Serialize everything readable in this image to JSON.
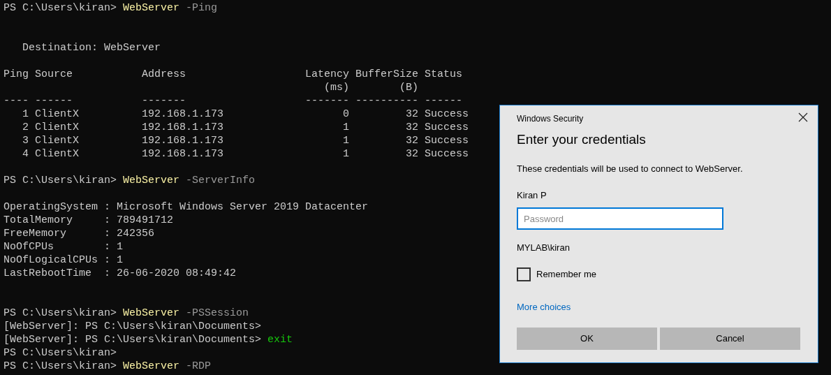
{
  "terminal": {
    "lines": [
      {
        "kind": "text",
        "segments": [
          {
            "kind": "prompt",
            "text": "PS C:\\Users\\kiran> "
          },
          {
            "kind": "command",
            "text": "WebServer"
          },
          {
            "kind": "param",
            "text": " -Ping"
          }
        ]
      },
      {
        "kind": "blank"
      },
      {
        "kind": "blank"
      },
      {
        "kind": "text",
        "segments": [
          {
            "kind": "prompt",
            "text": "   Destination: WebServer"
          }
        ]
      },
      {
        "kind": "blank"
      },
      {
        "kind": "text",
        "segments": [
          {
            "kind": "prompt",
            "text": "Ping Source           Address                   Latency BufferSize Status"
          }
        ]
      },
      {
        "kind": "text",
        "segments": [
          {
            "kind": "prompt",
            "text": "                                                   (ms)        (B)"
          }
        ]
      },
      {
        "kind": "text",
        "segments": [
          {
            "kind": "prompt",
            "text": "---- ------           -------                   ------- ---------- ------"
          }
        ]
      },
      {
        "kind": "text",
        "segments": [
          {
            "kind": "prompt",
            "text": "   1 ClientX          192.168.1.173                   0         32 Success"
          }
        ]
      },
      {
        "kind": "text",
        "segments": [
          {
            "kind": "prompt",
            "text": "   2 ClientX          192.168.1.173                   1         32 Success"
          }
        ]
      },
      {
        "kind": "text",
        "segments": [
          {
            "kind": "prompt",
            "text": "   3 ClientX          192.168.1.173                   1         32 Success"
          }
        ]
      },
      {
        "kind": "text",
        "segments": [
          {
            "kind": "prompt",
            "text": "   4 ClientX          192.168.1.173                   1         32 Success"
          }
        ]
      },
      {
        "kind": "blank"
      },
      {
        "kind": "text",
        "segments": [
          {
            "kind": "prompt",
            "text": "PS C:\\Users\\kiran> "
          },
          {
            "kind": "command",
            "text": "WebServer"
          },
          {
            "kind": "param",
            "text": " -ServerInfo"
          }
        ]
      },
      {
        "kind": "blank"
      },
      {
        "kind": "text",
        "segments": [
          {
            "kind": "prompt",
            "text": "OperatingSystem : Microsoft Windows Server 2019 Datacenter"
          }
        ]
      },
      {
        "kind": "text",
        "segments": [
          {
            "kind": "prompt",
            "text": "TotalMemory     : 789491712"
          }
        ]
      },
      {
        "kind": "text",
        "segments": [
          {
            "kind": "prompt",
            "text": "FreeMemory      : 242356"
          }
        ]
      },
      {
        "kind": "text",
        "segments": [
          {
            "kind": "prompt",
            "text": "NoOfCPUs        : 1"
          }
        ]
      },
      {
        "kind": "text",
        "segments": [
          {
            "kind": "prompt",
            "text": "NoOfLogicalCPUs : 1"
          }
        ]
      },
      {
        "kind": "text",
        "segments": [
          {
            "kind": "prompt",
            "text": "LastRebootTime  : 26-06-2020 08:49:42"
          }
        ]
      },
      {
        "kind": "blank"
      },
      {
        "kind": "blank"
      },
      {
        "kind": "text",
        "segments": [
          {
            "kind": "prompt",
            "text": "PS C:\\Users\\kiran> "
          },
          {
            "kind": "command",
            "text": "WebServer"
          },
          {
            "kind": "param",
            "text": " -PSSession"
          }
        ]
      },
      {
        "kind": "text",
        "segments": [
          {
            "kind": "prompt",
            "text": "[WebServer]: PS C:\\Users\\kiran\\Documents>"
          }
        ]
      },
      {
        "kind": "text",
        "segments": [
          {
            "kind": "prompt",
            "text": "[WebServer]: PS C:\\Users\\kiran\\Documents> "
          },
          {
            "kind": "keyword",
            "text": "exit"
          }
        ]
      },
      {
        "kind": "text",
        "segments": [
          {
            "kind": "prompt",
            "text": "PS C:\\Users\\kiran>"
          }
        ]
      },
      {
        "kind": "text",
        "segments": [
          {
            "kind": "prompt",
            "text": "PS C:\\Users\\kiran> "
          },
          {
            "kind": "command",
            "text": "WebServer"
          },
          {
            "kind": "param",
            "text": " -RDP"
          }
        ]
      }
    ]
  },
  "dialog": {
    "window_title": "Windows Security",
    "heading": "Enter your credentials",
    "message": "These credentials will be used to connect to WebServer.",
    "user_name": "Kiran P",
    "password": {
      "placeholder": "Password"
    },
    "account": "MYLAB\\kiran",
    "remember_me": {
      "label": "Remember me",
      "checked": false
    },
    "link": "More choices",
    "buttons": [
      "OK",
      "Cancel"
    ]
  }
}
